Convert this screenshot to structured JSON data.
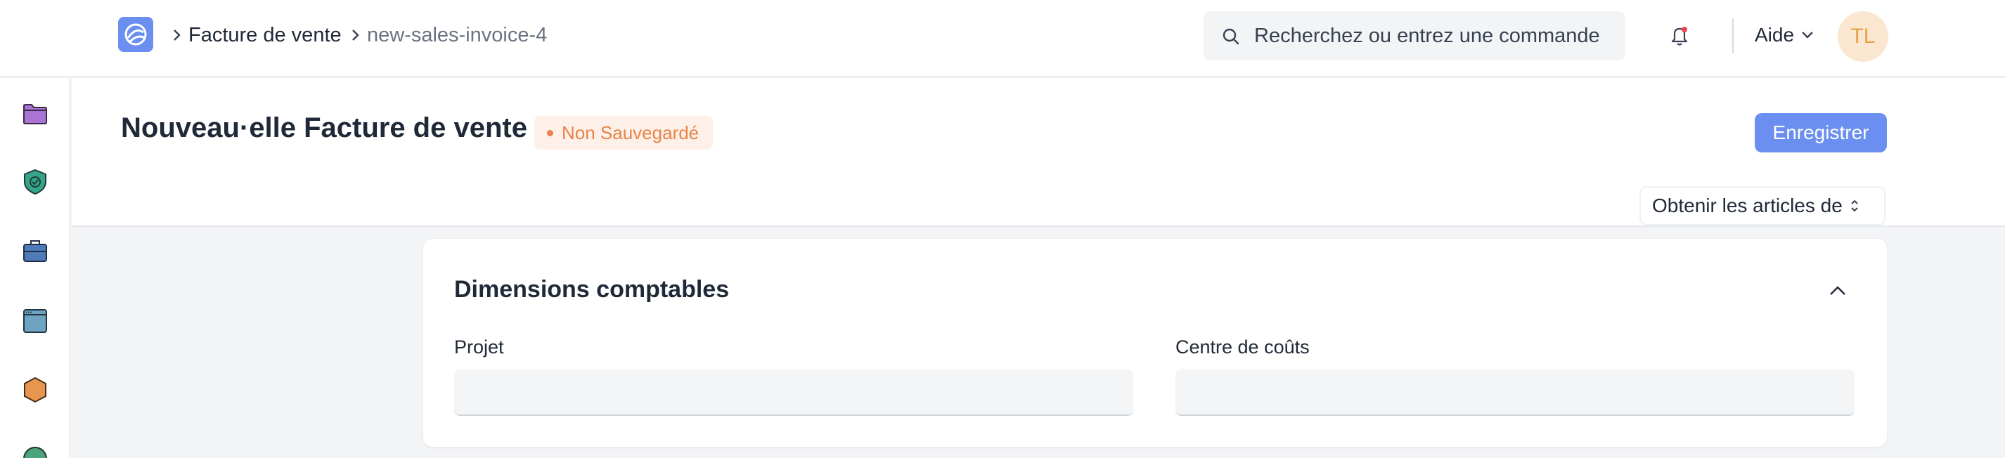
{
  "breadcrumb": {
    "items": [
      "Facture de vente",
      "new-sales-invoice-4"
    ]
  },
  "search": {
    "placeholder": "Recherchez ou entrez une commande"
  },
  "help": {
    "label": "Aide"
  },
  "avatar": {
    "initials": "TL"
  },
  "sidebar": {
    "icons": [
      "folder-icon",
      "shield-check-icon",
      "briefcase-icon",
      "window-icon",
      "hexagon-icon"
    ]
  },
  "page": {
    "title": "Nouveau·elle Facture de vente",
    "status": "Non Sauvegardé",
    "save_label": "Enregistrer",
    "get_items_label": "Obtenir les articles de"
  },
  "section": {
    "title": "Dimensions comptables",
    "fields": [
      {
        "label": "Projet",
        "value": ""
      },
      {
        "label": "Centre de coûts",
        "value": ""
      }
    ]
  },
  "colors": {
    "primary": "#6b8ff0",
    "warning": "#e8834a",
    "avatar_bg": "#fbe7cf"
  }
}
